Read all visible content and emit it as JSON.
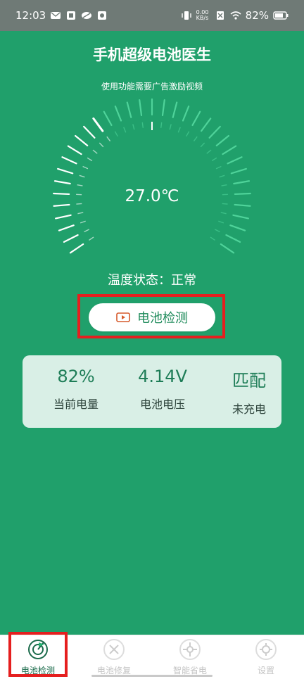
{
  "status": {
    "time": "12:03",
    "speed": "0.00\nKB/s",
    "battery": "82%"
  },
  "header": {
    "title": "手机超级电池医生",
    "subtitle": "使用功能需要广告激励视频"
  },
  "gauge": {
    "temperature": "27.0℃",
    "status_text": "温度状态：正常",
    "level": 0.35
  },
  "action": {
    "label": "电池检测"
  },
  "metrics": [
    {
      "value": "82%",
      "label": "当前电量"
    },
    {
      "value": "4.14V",
      "label": "电池电压"
    },
    {
      "value": "匹配",
      "label": "未充电"
    }
  ],
  "nav": [
    {
      "label": "电池检测",
      "icon": "battery-check-icon"
    },
    {
      "label": "电池修复",
      "icon": "repair-icon"
    },
    {
      "label": "智能省电",
      "icon": "power-save-icon"
    },
    {
      "label": "设置",
      "icon": "settings-icon"
    }
  ],
  "colors": {
    "primary": "#20a06b",
    "highlight": "#e51f1f"
  }
}
